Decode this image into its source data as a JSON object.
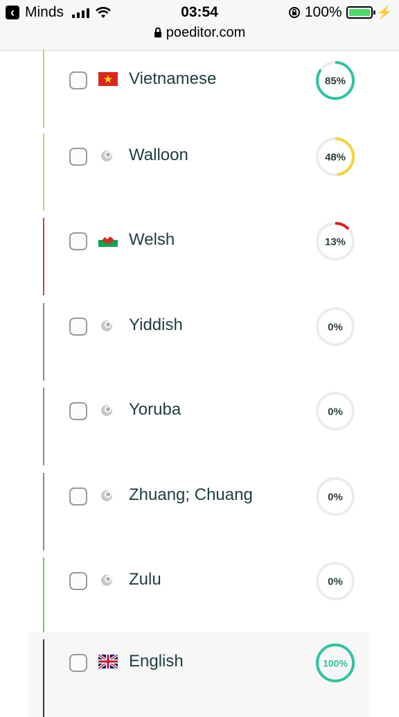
{
  "status_bar": {
    "back_app": "Minds",
    "time": "03:54",
    "battery_percent": "100%",
    "url": "poeditor.com"
  },
  "languages": [
    {
      "name": "Vietnamese",
      "percent_label": "85%",
      "percent": 85,
      "flag_icon": "vietnam-flag-icon",
      "bar_color": "#e2c84a",
      "ring_color": "#2ec4a0"
    },
    {
      "name": "Walloon",
      "percent_label": "48%",
      "percent": 48,
      "flag_icon": "generic-language-icon",
      "bar_color": "#e2c84a",
      "ring_color": "#f2d43a"
    },
    {
      "name": "Welsh",
      "percent_label": "13%",
      "percent": 13,
      "flag_icon": "wales-flag-icon",
      "bar_color": "#d23a3a",
      "ring_color": "#d62020"
    },
    {
      "name": "Yiddish",
      "percent_label": "0%",
      "percent": 0,
      "flag_icon": "generic-language-icon",
      "bar_color": "#8a8a8a",
      "ring_color": "#2ec4a0"
    },
    {
      "name": "Yoruba",
      "percent_label": "0%",
      "percent": 0,
      "flag_icon": "generic-language-icon",
      "bar_color": "#8a8a8a",
      "ring_color": "#2ec4a0"
    },
    {
      "name": "Zhuang; Chuang",
      "percent_label": "0%",
      "percent": 0,
      "flag_icon": "generic-language-icon",
      "bar_color": "#8a8a8a",
      "ring_color": "#2ec4a0"
    },
    {
      "name": "Zulu",
      "percent_label": "0%",
      "percent": 0,
      "flag_icon": "generic-language-icon",
      "bar_color": "#5fcf6a",
      "ring_color": "#2ec4a0"
    },
    {
      "name": "English",
      "percent_label": "100%",
      "percent": 100,
      "flag_icon": "uk-flag-icon",
      "bar_color": "#2d3e40",
      "ring_color": "#2ec4a0"
    }
  ]
}
